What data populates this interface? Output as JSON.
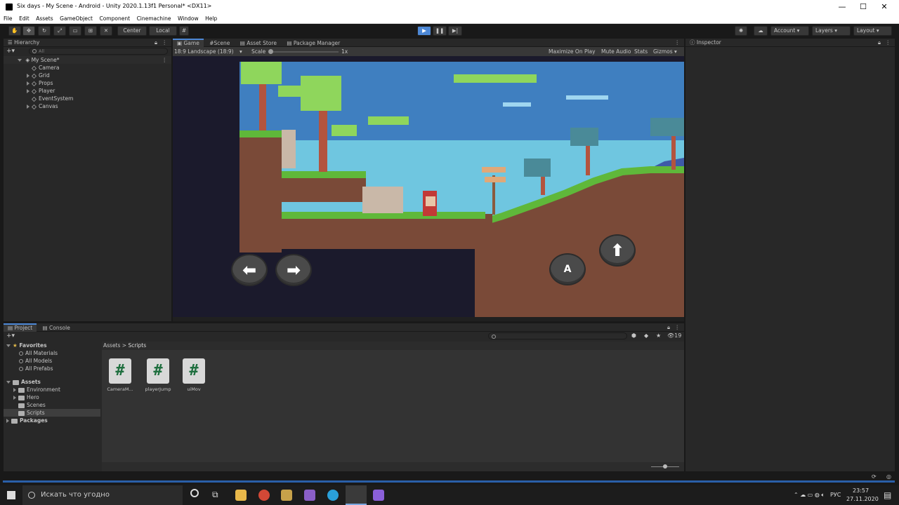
{
  "window": {
    "title": "Six days - My Scene - Android - Unity 2020.1.13f1 Personal* <DX11>"
  },
  "menu": [
    "File",
    "Edit",
    "Assets",
    "GameObject",
    "Component",
    "Cinemachine",
    "Window",
    "Help"
  ],
  "toolbar": {
    "center": "Center",
    "local": "Local",
    "account": "Account",
    "layers": "Layers",
    "layout": "Layout"
  },
  "hierarchy": {
    "tab": "Hierarchy",
    "search_placeholder": "All",
    "scene": "My Scene*",
    "items": [
      "Camera",
      "Grid",
      "Props",
      "Player",
      "EventSystem",
      "Canvas"
    ]
  },
  "center_tabs": [
    "Game",
    "Scene",
    "Asset Store",
    "Package Manager"
  ],
  "game_bar": {
    "aspect": "18:9 Landscape (18:9)",
    "scale_label": "Scale",
    "scale_value": "1x",
    "maximize": "Maximize On Play",
    "mute": "Mute Audio",
    "stats": "Stats",
    "gizmos": "Gizmos"
  },
  "inspector": {
    "tab": "Inspector"
  },
  "game_buttons": {
    "a_label": "A"
  },
  "project": {
    "tabs": [
      "Project",
      "Console"
    ],
    "favorites_label": "Favorites",
    "favorites": [
      "All Materials",
      "All Models",
      "All Prefabs"
    ],
    "assets_label": "Assets",
    "asset_folders": [
      "Environment",
      "Hero",
      "Scenes",
      "Scripts"
    ],
    "packages_label": "Packages",
    "breadcrumb_root": "Assets",
    "breadcrumb_current": "Scripts",
    "hidden_count": "19",
    "scripts": [
      "CameraM...",
      "playerJump",
      "uiMov"
    ]
  },
  "taskbar": {
    "search_placeholder": "Искать что угодно",
    "lang": "РУС",
    "time": "23:57",
    "date": "27.11.2020"
  }
}
